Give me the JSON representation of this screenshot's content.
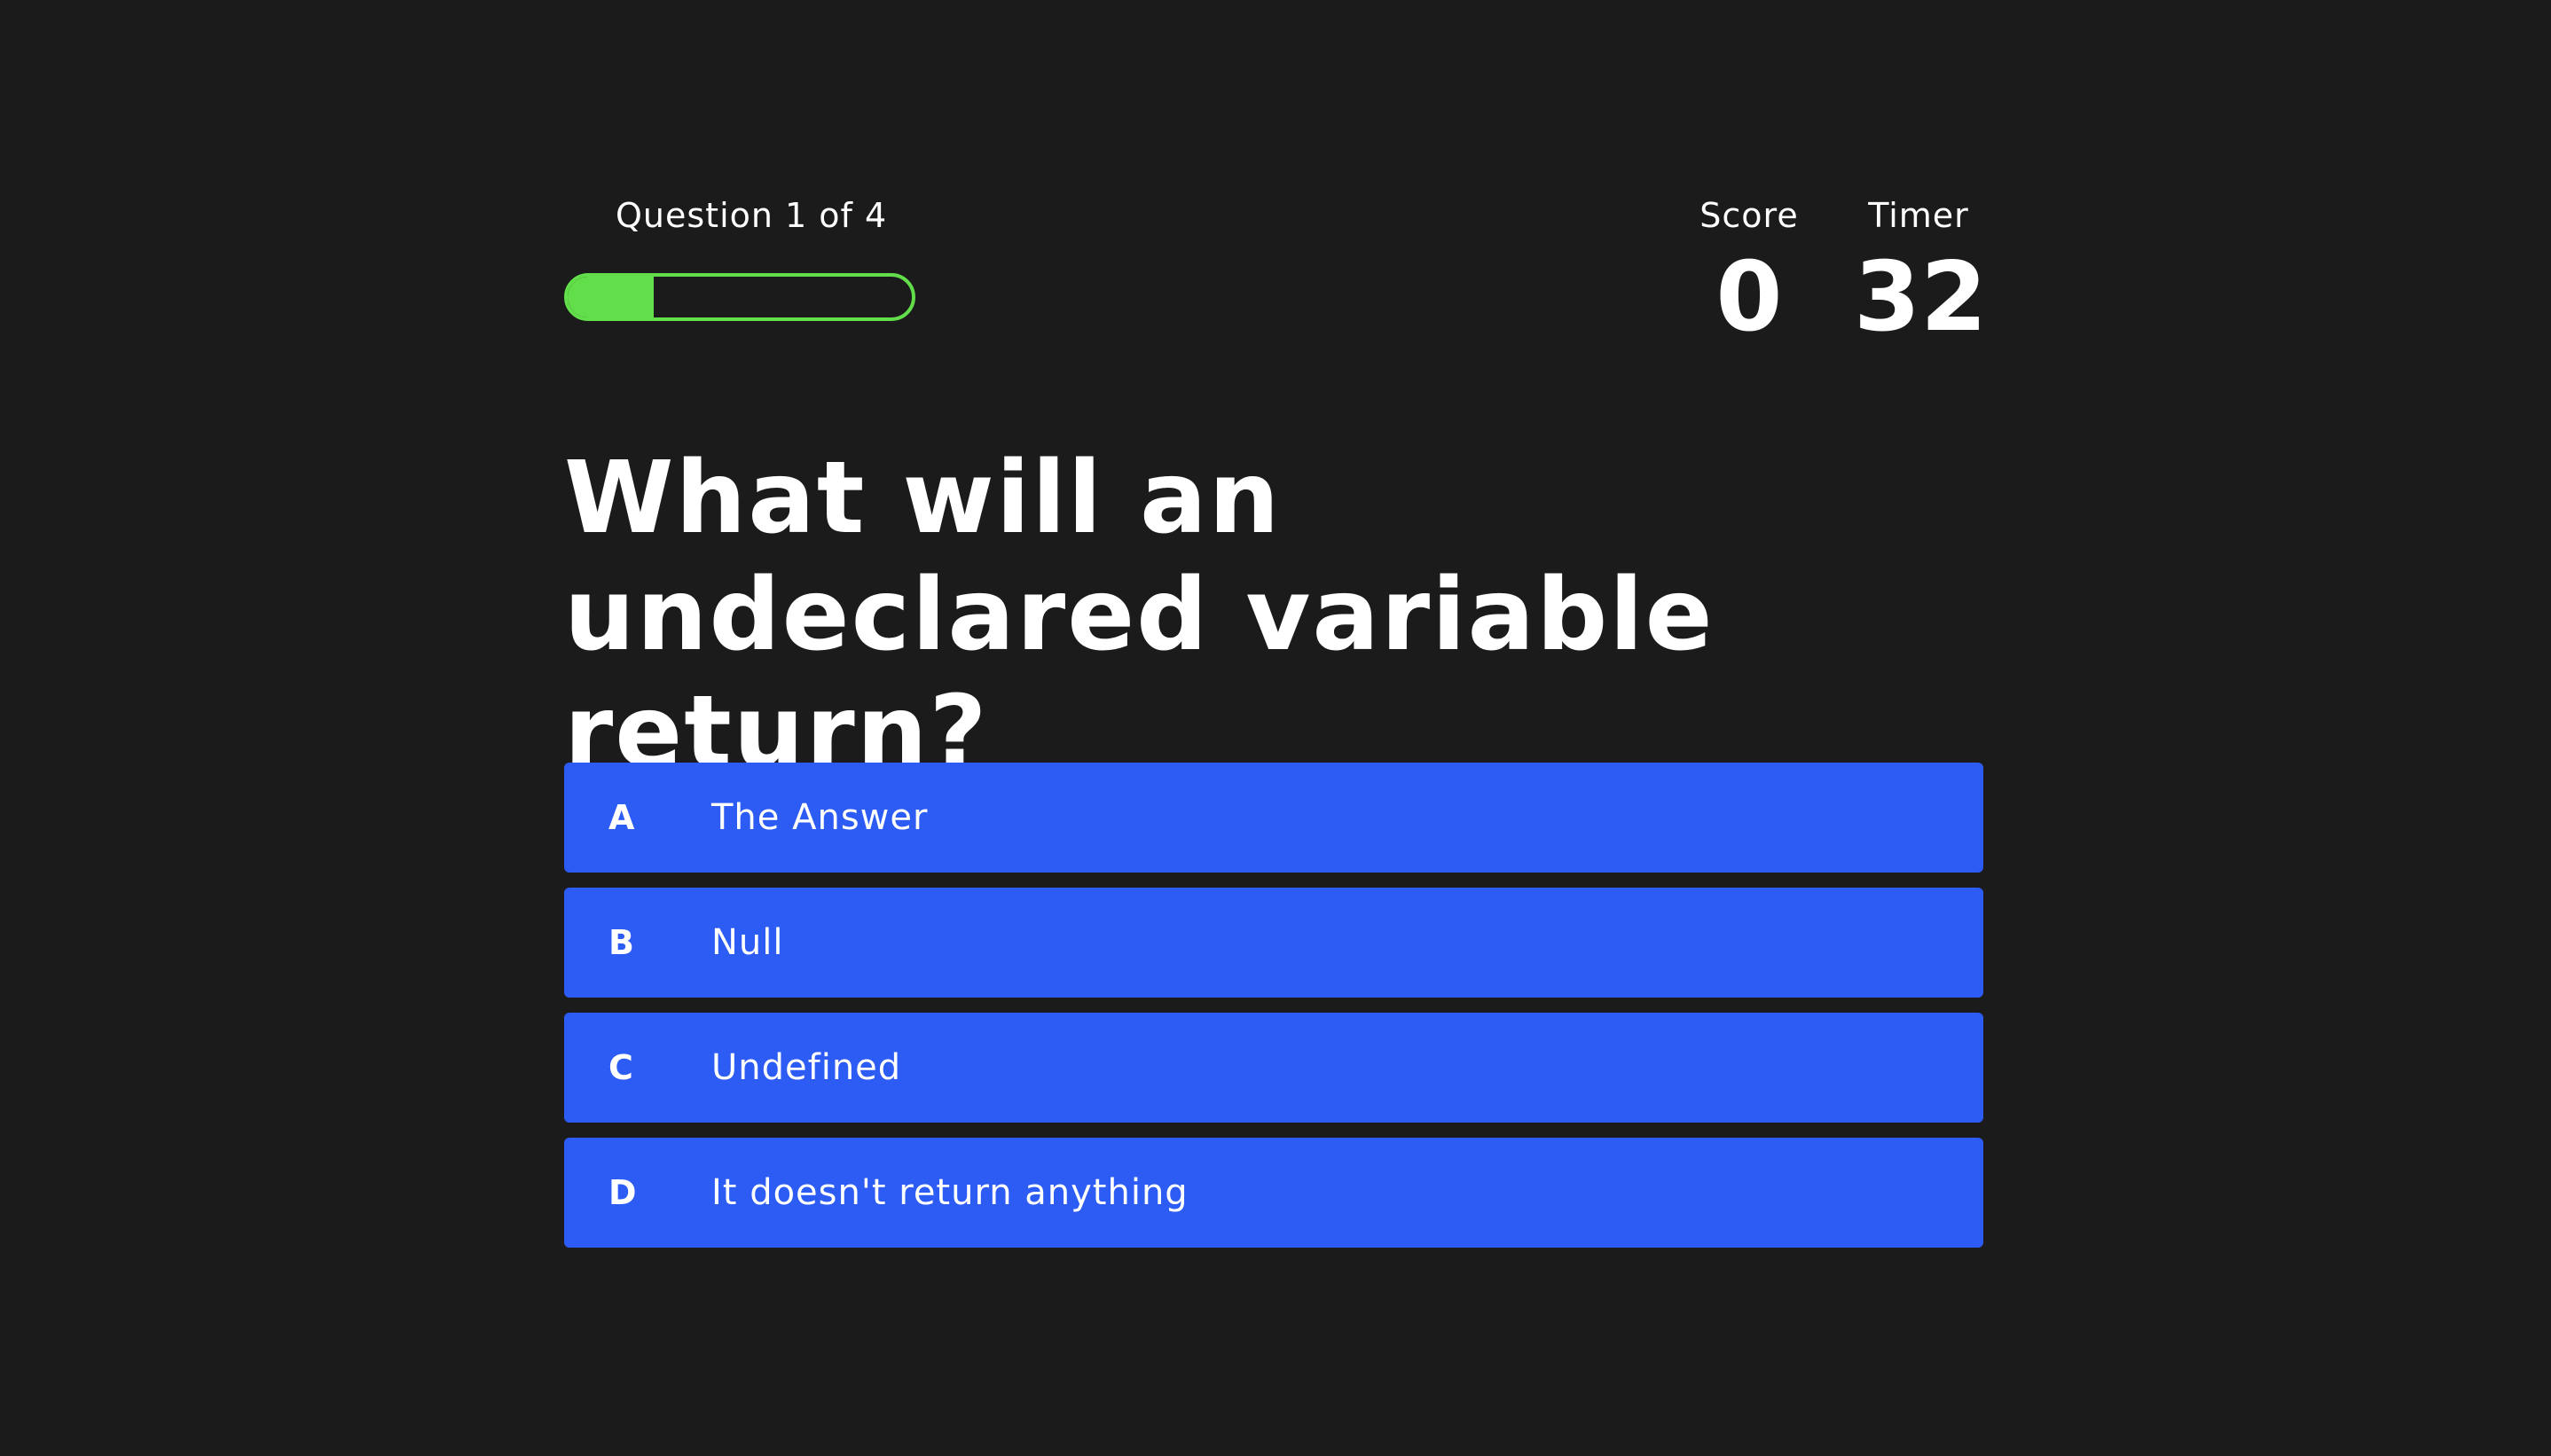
{
  "progress": {
    "label": "Question 1 of 4",
    "fraction": 0.25,
    "color": "#62de4a"
  },
  "score": {
    "label": "Score",
    "value": "0"
  },
  "timer": {
    "label": "Timer",
    "value": "32"
  },
  "question": {
    "text": "What will an undeclared variable return?"
  },
  "answers": [
    {
      "letter": "A",
      "text": "The Answer"
    },
    {
      "letter": "B",
      "text": "Null"
    },
    {
      "letter": "C",
      "text": "Undefined"
    },
    {
      "letter": "D",
      "text": "It doesn't return anything"
    }
  ],
  "colors": {
    "background": "#1c1b1c",
    "answer_background": "#2d5cf5",
    "text": "#ffffff"
  }
}
